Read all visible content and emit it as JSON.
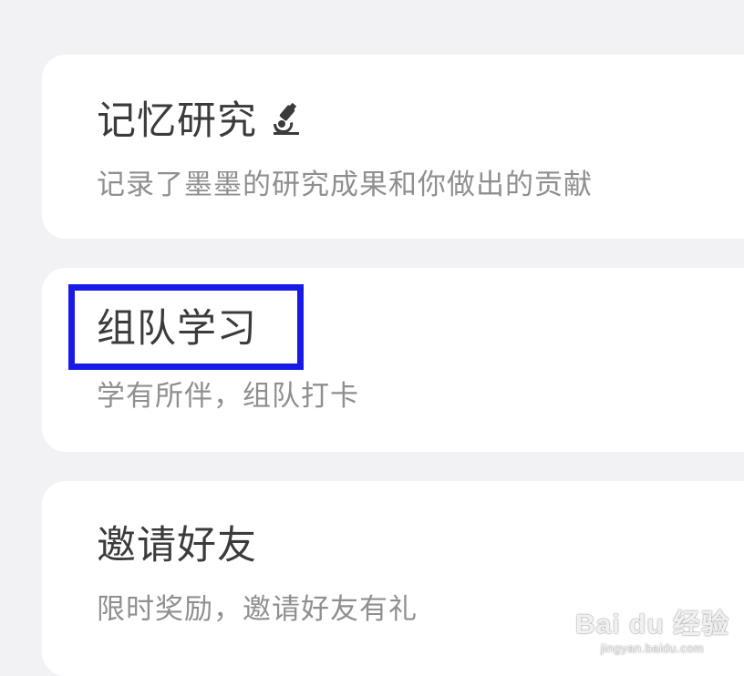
{
  "cards": [
    {
      "title": "记忆研究",
      "title_icon": "microscope-icon",
      "description": "记录了墨墨的研究成果和你做出的贡献"
    },
    {
      "title": "组队学习",
      "description": "学有所伴，组队打卡",
      "highlight_color": "#1a1ae6"
    },
    {
      "title": "邀请好友",
      "description": "限时奖励，邀请好友有礼"
    }
  ],
  "watermark": {
    "logo": "Bai du 经验",
    "url": "jingyan.baidu.com"
  }
}
